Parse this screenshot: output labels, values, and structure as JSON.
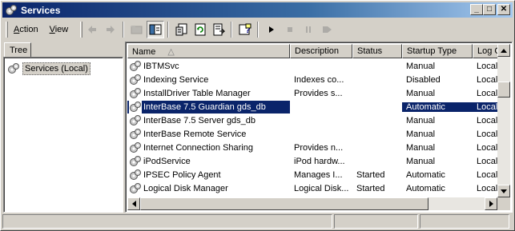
{
  "window": {
    "title": "Services",
    "minimize_glyph": "_",
    "maximize_glyph": "□",
    "close_glyph": "✕"
  },
  "menu": {
    "items": [
      {
        "accel": "A",
        "rest": "ction"
      },
      {
        "accel": "V",
        "rest": "iew"
      }
    ]
  },
  "toolbar": {
    "buttons": [
      "back-arrow-icon",
      "forward-arrow-icon",
      "up-folder-icon",
      "show-hide-tree-icon",
      "properties-icon",
      "refresh-icon",
      "export-list-icon",
      "help-icon",
      "start-service-icon",
      "stop-service-icon",
      "pause-service-icon",
      "restart-service-icon"
    ]
  },
  "tree": {
    "tab_label": "Tree",
    "root_label": "Services (Local)"
  },
  "list": {
    "columns": [
      "Name",
      "Description",
      "Status",
      "Startup Type",
      "Log On As"
    ],
    "sort_glyph": "△",
    "rows": [
      {
        "name": "IBTMSvc",
        "description": "",
        "status": "",
        "startup": "Manual",
        "logon": "LocalS"
      },
      {
        "name": "Indexing Service",
        "description": "Indexes co...",
        "status": "",
        "startup": "Disabled",
        "logon": "LocalS"
      },
      {
        "name": "InstallDriver Table Manager",
        "description": "Provides s...",
        "status": "",
        "startup": "Manual",
        "logon": "LocalS"
      },
      {
        "name": "InterBase 7.5 Guardian gds_db",
        "description": "",
        "status": "",
        "startup": "Automatic",
        "logon": "LocalS",
        "selected": true
      },
      {
        "name": "InterBase 7.5 Server gds_db",
        "description": "",
        "status": "",
        "startup": "Manual",
        "logon": "LocalS"
      },
      {
        "name": "InterBase Remote Service",
        "description": "",
        "status": "",
        "startup": "Manual",
        "logon": "LocalS"
      },
      {
        "name": "Internet Connection Sharing",
        "description": "Provides n...",
        "status": "",
        "startup": "Manual",
        "logon": "LocalS"
      },
      {
        "name": "iPodService",
        "description": "iPod hardw...",
        "status": "",
        "startup": "Manual",
        "logon": "LocalS"
      },
      {
        "name": "IPSEC Policy Agent",
        "description": "Manages I...",
        "status": "Started",
        "startup": "Automatic",
        "logon": "LocalS"
      },
      {
        "name": "Logical Disk Manager",
        "description": "Logical Disk...",
        "status": "Started",
        "startup": "Automatic",
        "logon": "LocalS"
      }
    ]
  },
  "colors": {
    "titlebar_start": "#0a246a",
    "titlebar_end": "#a6caf0",
    "selection": "#0a246a",
    "chrome": "#d4d0c8"
  }
}
